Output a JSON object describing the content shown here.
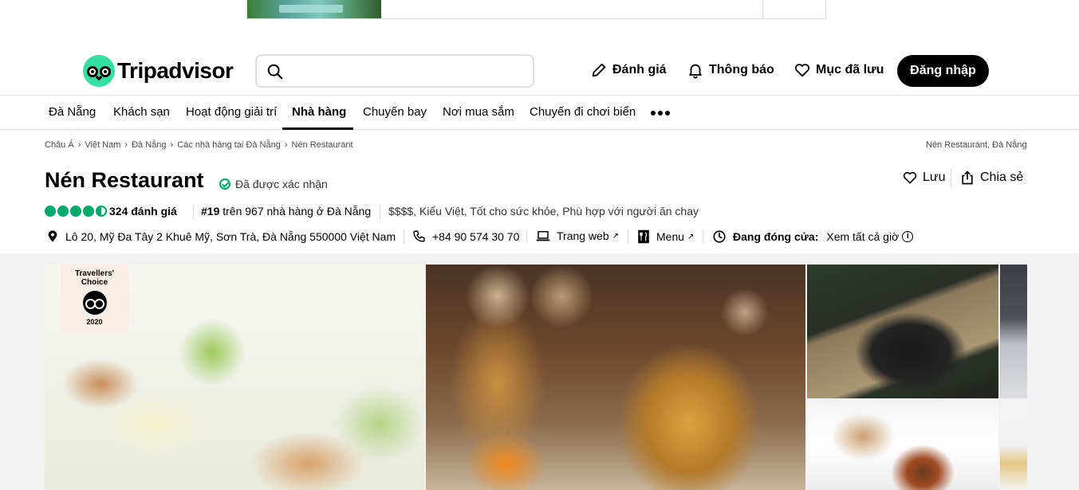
{
  "header": {
    "logo_text": "Tripadvisor",
    "search_placeholder": "",
    "actions": {
      "review": "Đánh giá",
      "notifications": "Thông báo",
      "saved": "Mục đã lưu",
      "login": "Đăng nhập"
    }
  },
  "nav": {
    "items": [
      "Đà Nẵng",
      "Khách sạn",
      "Hoạt động giải trí",
      "Nhà hàng",
      "Chuyến bay",
      "Nơi mua sắm",
      "Chuyến đi chơi biển"
    ],
    "active": "Nhà hàng"
  },
  "breadcrumbs": [
    "Châu Á",
    "Việt Nam",
    "Đà Nẵng",
    "Các nhà hàng tại Đà Nẵng",
    "Nén Restaurant"
  ],
  "breadcrumb_right": "Nén Restaurant, Đà Nẵng",
  "restaurant": {
    "name": "Nén Restaurant",
    "verified": "Đã được xác nhận",
    "rating": 4.5,
    "reviews": "324 đánh giá",
    "rank_num": "#19",
    "rank_text": " trên 967 nhà hàng ở Đà Nẵng",
    "cuisine": "$$$$, Kiểu Việt, Tốt cho sức khỏe, Phù hợp với người ăn chay",
    "address": "Lô 20, Mỹ Đa Tây 2 Khuê Mỹ, Sơn Trà, Đà Nẵng 550000 Việt Nam",
    "phone": "+84 90 574 30 70",
    "website": "Trang web",
    "menu": "Menu",
    "status": "Đang đóng cửa:",
    "hours": "Xem tất cả giờ"
  },
  "actions": {
    "save": "Lưu",
    "share": "Chia sẻ"
  },
  "badge": {
    "line1": "Travellers'",
    "line2": "Choice",
    "year": "2020"
  },
  "colors": {
    "brand_green": "#34e0a1",
    "rating_green": "#00aa6c",
    "login_bg": "#000000"
  }
}
